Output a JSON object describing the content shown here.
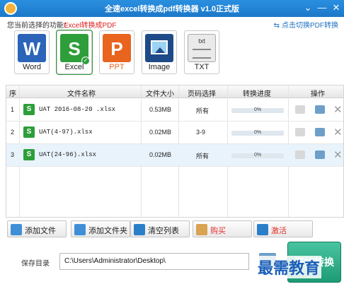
{
  "window": {
    "title": "全速excel转换成pdf转换器 v1.0正式版",
    "menu_glyph": "⌄",
    "minimize_glyph": "—",
    "close_glyph": "✕"
  },
  "mode": {
    "label": "您当前选择的功能：",
    "value": "Excel转换成PDF",
    "switch_link": "点击切换PDF转换"
  },
  "formats": [
    {
      "letter": "W",
      "label": "Word"
    },
    {
      "letter": "S",
      "label": "Excel",
      "selected": true
    },
    {
      "letter": "P",
      "label": "PPT"
    },
    {
      "letter": "",
      "label": "Image"
    },
    {
      "letter": "txt",
      "label": "TXT"
    }
  ],
  "table": {
    "headers": [
      "序",
      "文件名称",
      "文件大小",
      "页码选择",
      "转换进度",
      "操作"
    ],
    "rows": [
      {
        "index": "1",
        "name": "UAT 2016-08-20 .xlsx",
        "size": "0.53MB",
        "pages": "所有",
        "progress": "0%",
        "progress_value": 0
      },
      {
        "index": "2",
        "name": "UAT(4-97).xlsx",
        "size": "0.02MB",
        "pages": "3-9",
        "progress": "0%",
        "progress_value": 0
      },
      {
        "index": "3",
        "name": "UAT(24-96).xlsx",
        "size": "0.02MB",
        "pages": "所有",
        "progress": "0%",
        "progress_value": 0,
        "selected": true
      }
    ]
  },
  "actions": {
    "add_file": "添加文件",
    "add_folder": "添加文件夹",
    "clear_list": "清空列表",
    "buy": "购买",
    "activate": "激活"
  },
  "save": {
    "label": "保存目录",
    "path": "C:\\Users\\Administrator\\Desktop\\"
  },
  "convert_label": "开始转换",
  "watermark": "最需教育",
  "colors": {
    "titlebar": "#1c78c9",
    "accent_red": "#e02020",
    "excel_green": "#2e9e3a",
    "convert_green": "#1d9c74"
  }
}
